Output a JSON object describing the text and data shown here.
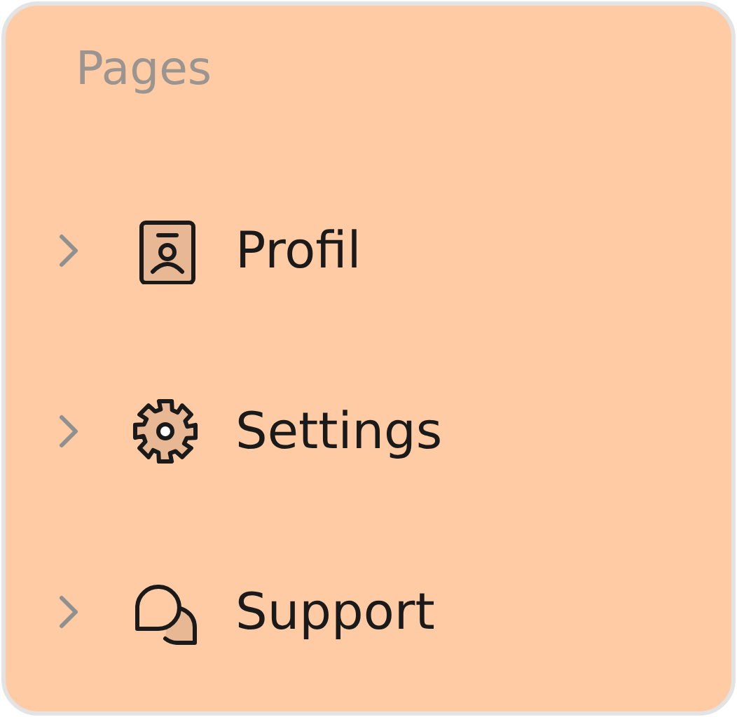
{
  "heading": "Pages",
  "items": [
    {
      "label": "Profil",
      "kind": "badge",
      "expanded": false
    },
    {
      "label": "Settings",
      "kind": "gear",
      "expanded": false
    },
    {
      "label": "Support",
      "kind": "chat",
      "expanded": false
    }
  ]
}
